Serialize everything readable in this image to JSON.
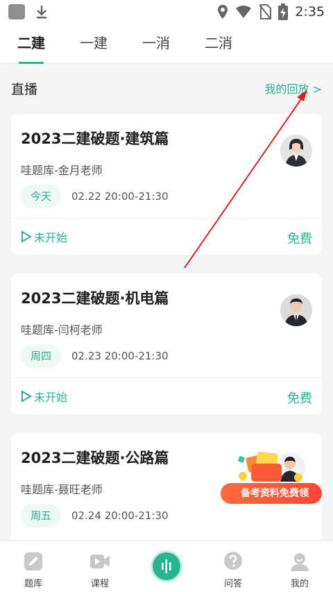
{
  "status_bar": {
    "time": "2:35",
    "icons": [
      "app-square-icon",
      "download-icon",
      "location-icon",
      "wifi-icon",
      "no-sim-icon",
      "battery-charging-icon"
    ]
  },
  "tabs": [
    {
      "label": "二建",
      "active": true
    },
    {
      "label": "一建",
      "active": false
    },
    {
      "label": "一消",
      "active": false
    },
    {
      "label": "二消",
      "active": false
    }
  ],
  "section": {
    "title": "直播",
    "link": "我的回放 >"
  },
  "cards": [
    {
      "title": "2023二建破题·建筑篇",
      "teacher": "哇题库-金月老师",
      "day": "今天",
      "datetime": "02.22  20:00-21:30",
      "status": "未开始",
      "price": "免费"
    },
    {
      "title": "2023二建破题·机电篇",
      "teacher": "哇题库-闫柯老师",
      "day": "周四",
      "datetime": "02.23  20:00-21:30",
      "status": "未开始",
      "price": "免费"
    },
    {
      "title": "2023二建破题·公路篇",
      "teacher": "哇题库-聂旺老师",
      "day": "周五",
      "datetime": "02.24  20:00-21:30",
      "status": "",
      "price": ""
    }
  ],
  "promo": {
    "label": "备考资料免费领"
  },
  "bottom_nav": [
    {
      "label": "题库",
      "icon": "pencil-icon"
    },
    {
      "label": "课程",
      "icon": "video-play-icon"
    },
    {
      "label": "",
      "icon": "soundwave-icon"
    },
    {
      "label": "问答",
      "icon": "question-icon"
    },
    {
      "label": "我的",
      "icon": "profile-icon"
    }
  ],
  "colors": {
    "accent": "#26b58f",
    "promo": "#ff4536",
    "annotation_arrow": "#e02020"
  }
}
